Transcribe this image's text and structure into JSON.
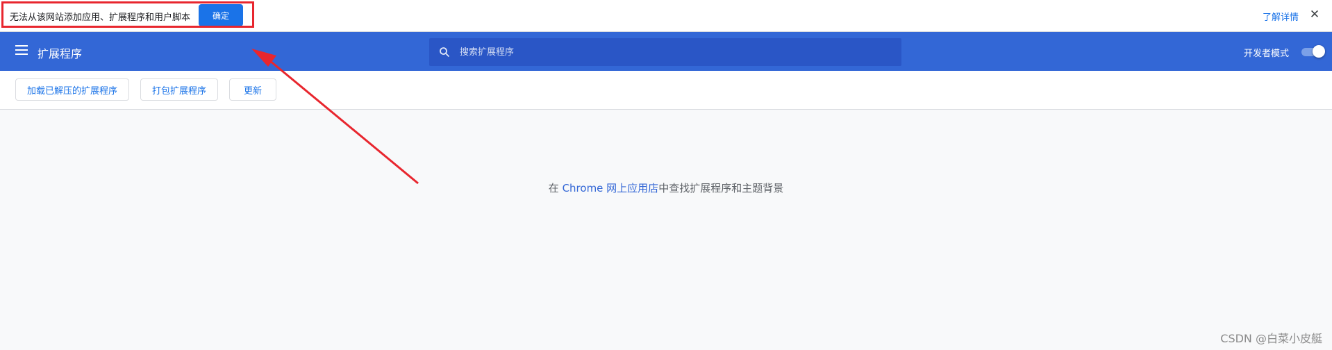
{
  "infobar": {
    "message": "无法从该网站添加应用、扩展程序和用户脚本",
    "ok_label": "确定",
    "learn_more": "了解详情",
    "close_glyph": "✕"
  },
  "toolbar": {
    "title": "扩展程序",
    "search_placeholder": "搜索扩展程序",
    "dev_mode_label": "开发者模式",
    "dev_mode_on": true
  },
  "actions": {
    "load_unpacked": "加载已解压的扩展程序",
    "pack": "打包扩展程序",
    "update": "更新"
  },
  "main": {
    "prefix": "在 ",
    "link": "Chrome 网上应用店",
    "suffix": "中查找扩展程序和主题背景"
  },
  "watermark": "CSDN @白菜小皮艇",
  "colors": {
    "toolbar": "#3367d6",
    "search": "#2a56c6",
    "accent": "#1a73e8",
    "annotation": "#e8262e"
  }
}
